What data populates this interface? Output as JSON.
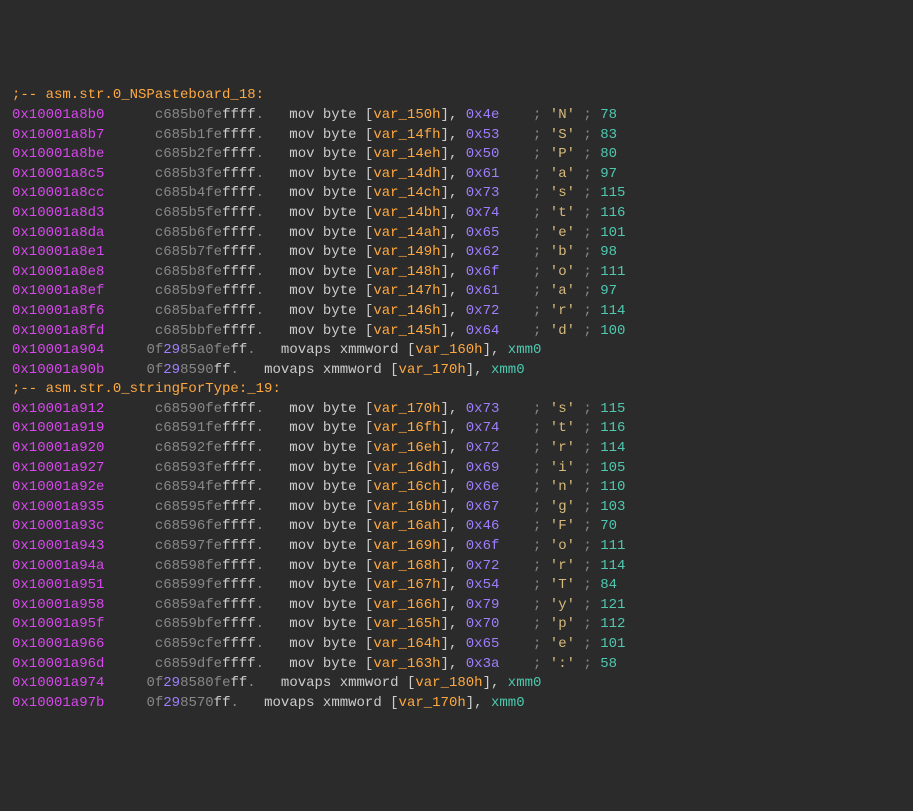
{
  "labels": [
    ";-- asm.str.0_NSPasteboard_18:",
    ";-- asm.str.0_stringForType:_19:"
  ],
  "lines": [
    {
      "type": "mov",
      "addr": "0x10001a8b0",
      "hex1": "c685b0fe",
      "hex2": "ffff",
      "suffix": ".",
      "var": "var_150h",
      "val": "0x4e",
      "char": "'N'",
      "dec": "78"
    },
    {
      "type": "mov",
      "addr": "0x10001a8b7",
      "hex1": "c685b1fe",
      "hex2": "ffff",
      "suffix": ".",
      "var": "var_14fh",
      "val": "0x53",
      "char": "'S'",
      "dec": "83"
    },
    {
      "type": "mov",
      "addr": "0x10001a8be",
      "hex1": "c685b2fe",
      "hex2": "ffff",
      "suffix": ".",
      "var": "var_14eh",
      "val": "0x50",
      "char": "'P'",
      "dec": "80"
    },
    {
      "type": "mov",
      "addr": "0x10001a8c5",
      "hex1": "c685b3fe",
      "hex2": "ffff",
      "suffix": ".",
      "var": "var_14dh",
      "val": "0x61",
      "char": "'a'",
      "dec": "97"
    },
    {
      "type": "mov",
      "addr": "0x10001a8cc",
      "hex1": "c685b4fe",
      "hex2": "ffff",
      "suffix": ".",
      "var": "var_14ch",
      "val": "0x73",
      "char": "'s'",
      "dec": "115"
    },
    {
      "type": "mov",
      "addr": "0x10001a8d3",
      "hex1": "c685b5fe",
      "hex2": "ffff",
      "suffix": ".",
      "var": "var_14bh",
      "val": "0x74",
      "char": "'t'",
      "dec": "116"
    },
    {
      "type": "mov",
      "addr": "0x10001a8da",
      "hex1": "c685b6fe",
      "hex2": "ffff",
      "suffix": ".",
      "var": "var_14ah",
      "val": "0x65",
      "char": "'e'",
      "dec": "101"
    },
    {
      "type": "mov",
      "addr": "0x10001a8e1",
      "hex1": "c685b7fe",
      "hex2": "ffff",
      "suffix": ".",
      "var": "var_149h",
      "val": "0x62",
      "char": "'b'",
      "dec": "98"
    },
    {
      "type": "mov",
      "addr": "0x10001a8e8",
      "hex1": "c685b8fe",
      "hex2": "ffff",
      "suffix": ".",
      "var": "var_148h",
      "val": "0x6f",
      "char": "'o'",
      "dec": "111"
    },
    {
      "type": "mov",
      "addr": "0x10001a8ef",
      "hex1": "c685b9fe",
      "hex2": "ffff",
      "suffix": ".",
      "var": "var_147h",
      "val": "0x61",
      "char": "'a'",
      "dec": "97"
    },
    {
      "type": "mov",
      "addr": "0x10001a8f6",
      "hex1": "c685bafe",
      "hex2": "ffff",
      "suffix": ".",
      "var": "var_146h",
      "val": "0x72",
      "char": "'r'",
      "dec": "114"
    },
    {
      "type": "mov",
      "addr": "0x10001a8fd",
      "hex1": "c685bbfe",
      "hex2": "ffff",
      "suffix": ".",
      "var": "var_145h",
      "val": "0x64",
      "char": "'d'",
      "dec": "100"
    },
    {
      "type": "movaps",
      "addr": "0x10001a904",
      "hexpre": "0f",
      "hexmid": "29",
      "hex1": "85a0fe",
      "hex2": "ff",
      "suffix": ".",
      "var": "var_160h"
    },
    {
      "type": "movaps",
      "addr": "0x10001a90b",
      "hexpre": "0f",
      "hexmid": "29",
      "hex1": "8590",
      "hex2": "ff",
      "suffix": ".",
      "var": "var_170h"
    },
    {
      "type": "mov",
      "addr": "0x10001a912",
      "hex1": "c68590fe",
      "hex2": "ffff",
      "suffix": ".",
      "var": "var_170h",
      "val": "0x73",
      "char": "'s'",
      "dec": "115"
    },
    {
      "type": "mov",
      "addr": "0x10001a919",
      "hex1": "c68591fe",
      "hex2": "ffff",
      "suffix": ".",
      "var": "var_16fh",
      "val": "0x74",
      "char": "'t'",
      "dec": "116"
    },
    {
      "type": "mov",
      "addr": "0x10001a920",
      "hex1": "c68592fe",
      "hex2": "ffff",
      "suffix": ".",
      "var": "var_16eh",
      "val": "0x72",
      "char": "'r'",
      "dec": "114"
    },
    {
      "type": "mov",
      "addr": "0x10001a927",
      "hex1": "c68593fe",
      "hex2": "ffff",
      "suffix": ".",
      "var": "var_16dh",
      "val": "0x69",
      "char": "'i'",
      "dec": "105"
    },
    {
      "type": "mov",
      "addr": "0x10001a92e",
      "hex1": "c68594fe",
      "hex2": "ffff",
      "suffix": ".",
      "var": "var_16ch",
      "val": "0x6e",
      "char": "'n'",
      "dec": "110"
    },
    {
      "type": "mov",
      "addr": "0x10001a935",
      "hex1": "c68595fe",
      "hex2": "ffff",
      "suffix": ".",
      "var": "var_16bh",
      "val": "0x67",
      "char": "'g'",
      "dec": "103"
    },
    {
      "type": "mov",
      "addr": "0x10001a93c",
      "hex1": "c68596fe",
      "hex2": "ffff",
      "suffix": ".",
      "var": "var_16ah",
      "val": "0x46",
      "char": "'F'",
      "dec": "70"
    },
    {
      "type": "mov",
      "addr": "0x10001a943",
      "hex1": "c68597fe",
      "hex2": "ffff",
      "suffix": ".",
      "var": "var_169h",
      "val": "0x6f",
      "char": "'o'",
      "dec": "111"
    },
    {
      "type": "mov",
      "addr": "0x10001a94a",
      "hex1": "c68598fe",
      "hex2": "ffff",
      "suffix": ".",
      "var": "var_168h",
      "val": "0x72",
      "char": "'r'",
      "dec": "114"
    },
    {
      "type": "mov",
      "addr": "0x10001a951",
      "hex1": "c68599fe",
      "hex2": "ffff",
      "suffix": ".",
      "var": "var_167h",
      "val": "0x54",
      "char": "'T'",
      "dec": "84"
    },
    {
      "type": "mov",
      "addr": "0x10001a958",
      "hex1": "c6859afe",
      "hex2": "ffff",
      "suffix": ".",
      "var": "var_166h",
      "val": "0x79",
      "char": "'y'",
      "dec": "121"
    },
    {
      "type": "mov",
      "addr": "0x10001a95f",
      "hex1": "c6859bfe",
      "hex2": "ffff",
      "suffix": ".",
      "var": "var_165h",
      "val": "0x70",
      "char": "'p'",
      "dec": "112"
    },
    {
      "type": "mov",
      "addr": "0x10001a966",
      "hex1": "c6859cfe",
      "hex2": "ffff",
      "suffix": ".",
      "var": "var_164h",
      "val": "0x65",
      "char": "'e'",
      "dec": "101"
    },
    {
      "type": "mov",
      "addr": "0x10001a96d",
      "hex1": "c6859dfe",
      "hex2": "ffff",
      "suffix": ".",
      "var": "var_163h",
      "val": "0x3a",
      "char": "':'",
      "dec": "58"
    },
    {
      "type": "movaps",
      "addr": "0x10001a974",
      "hexpre": "0f",
      "hexmid": "29",
      "hex1": "8580fe",
      "hex2": "ff",
      "suffix": ".",
      "var": "var_180h"
    },
    {
      "type": "movaps",
      "addr": "0x10001a97b",
      "hexpre": "0f",
      "hexmid": "29",
      "hex1": "8570",
      "hex2": "ff",
      "suffix": ".",
      "var": "var_170h"
    }
  ],
  "tokens": {
    "movbyte": "mov byte ",
    "movapsxmm": "movaps xmmword ",
    "xmm0": "xmm0",
    "semi": ";"
  }
}
